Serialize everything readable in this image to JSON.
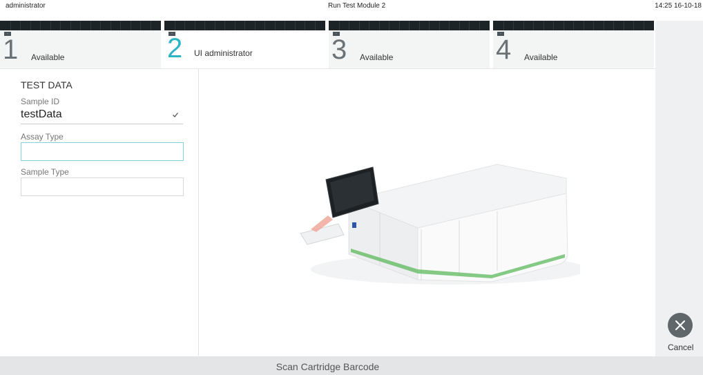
{
  "header": {
    "user": "administrator",
    "title": "Run Test Module 2",
    "clock": "14:25 16-10-18"
  },
  "tabs": [
    {
      "number": "1",
      "label": "Available",
      "timer": "--:--",
      "active": false
    },
    {
      "number": "2",
      "label": "UI administrator",
      "timer": "--:--",
      "active": true
    },
    {
      "number": "3",
      "label": "Available",
      "timer": "--:--",
      "active": false
    },
    {
      "number": "4",
      "label": "Available",
      "timer": "--:--",
      "active": false
    }
  ],
  "test_data": {
    "heading": "TEST DATA",
    "sample_id": {
      "label": "Sample ID",
      "value": "testData"
    },
    "assay_type": {
      "label": "Assay Type",
      "value": ""
    },
    "sample_type": {
      "label": "Sample Type",
      "value": ""
    }
  },
  "actions": {
    "cancel_label": "Cancel"
  },
  "status": {
    "message": "Scan Cartridge Barcode"
  },
  "colors": {
    "accent": "#2bb5c4",
    "tab_strip": "#1c2427",
    "cancel_button": "#5f676b"
  },
  "icons": {
    "check": "check-icon",
    "cancel": "close-icon"
  }
}
